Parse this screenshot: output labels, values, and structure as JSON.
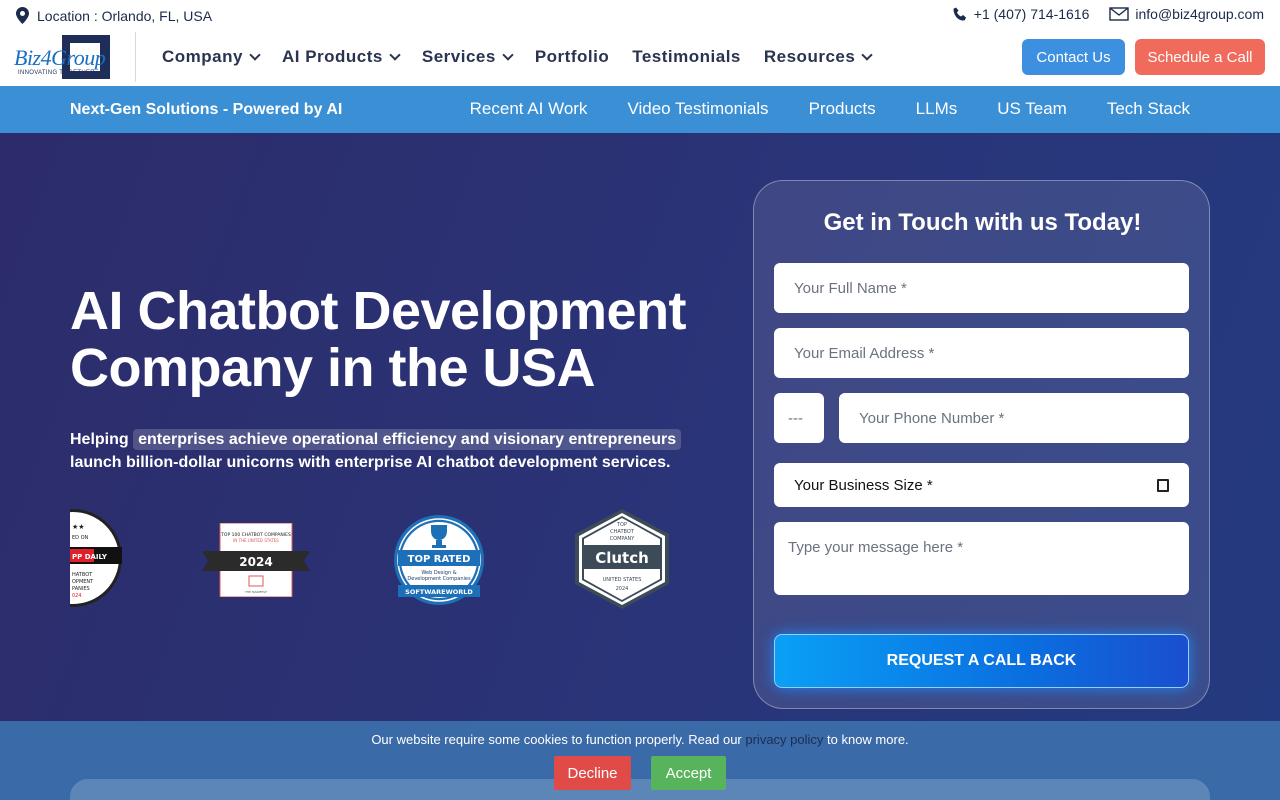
{
  "topbar": {
    "location": "Location : Orlando, FL, USA",
    "phone": "+1 (407) 714-1616",
    "email": "info@biz4group.com"
  },
  "logo": {
    "text": "Biz4Group",
    "tagline": "INNOVATING TOGETHER"
  },
  "nav": {
    "items": [
      {
        "label": "Company",
        "dropdown": true
      },
      {
        "label": "AI Products",
        "dropdown": true
      },
      {
        "label": "Services",
        "dropdown": true
      },
      {
        "label": "Portfolio",
        "dropdown": false
      },
      {
        "label": "Testimonials",
        "dropdown": false
      },
      {
        "label": "Resources",
        "dropdown": true
      }
    ],
    "contact_label": "Contact Us",
    "schedule_label": "Schedule a Call"
  },
  "subbar": {
    "tagline": "Next-Gen Solutions - Powered by AI",
    "links": [
      "Recent AI Work",
      "Video Testimonials",
      "Products",
      "LLMs",
      "US Team",
      "Tech Stack"
    ]
  },
  "hero": {
    "title": "AI Chatbot Development Company in the USA",
    "desc_prefix": "Helping ",
    "desc_highlight": "enterprises achieve operational efficiency and visionary entrepreneurs",
    "desc_suffix": "launch billion-dollar unicorns with enterprise AI chatbot development services.",
    "badges": {
      "appdaily": {
        "featured": "ED ON",
        "brand": "PP DAILY",
        "line1": "HATBOT",
        "line2": "OPMENT",
        "line3": "PANIES",
        "year": "024"
      },
      "manifest": {
        "line1": "TOP 100 CHATBOT COMPANIES",
        "line2": "IN THE UNITED STATES",
        "year": "2024",
        "brand": "THE MANIFEST"
      },
      "softwareworld": {
        "rating": "TOP RATED",
        "line1": "Web Design &",
        "line2": "Development Companies",
        "brand": "SOFTWAREWORLD"
      },
      "clutch": {
        "line1": "TOP",
        "line2": "CHATBOT",
        "line3": "COMPANY",
        "brand": "Clutch",
        "region": "UNITED STATES",
        "year": "2024"
      }
    }
  },
  "form": {
    "title": "Get in Touch with us Today!",
    "name_placeholder": "Your Full Name *",
    "email_placeholder": "Your Email Address *",
    "code_placeholder": "---",
    "phone_placeholder": "Your Phone Number *",
    "size_label": "Your Business Size *",
    "message_placeholder": "Type your message here *",
    "submit_label": "REQUEST A CALL BACK"
  },
  "cookie": {
    "text_before": "Our website require some cookies to function properly. Read our ",
    "link": "privacy policy",
    "text_after": " to know more.",
    "decline_label": "Decline",
    "accept_label": "Accept"
  },
  "colors": {
    "accent_blue": "#3b8fd4",
    "contact_button": "#3d8fe0",
    "schedule_button": "#f06b5b",
    "hero_bg": "#2a3478",
    "decline": "#e04b48",
    "accept": "#58b45c"
  }
}
